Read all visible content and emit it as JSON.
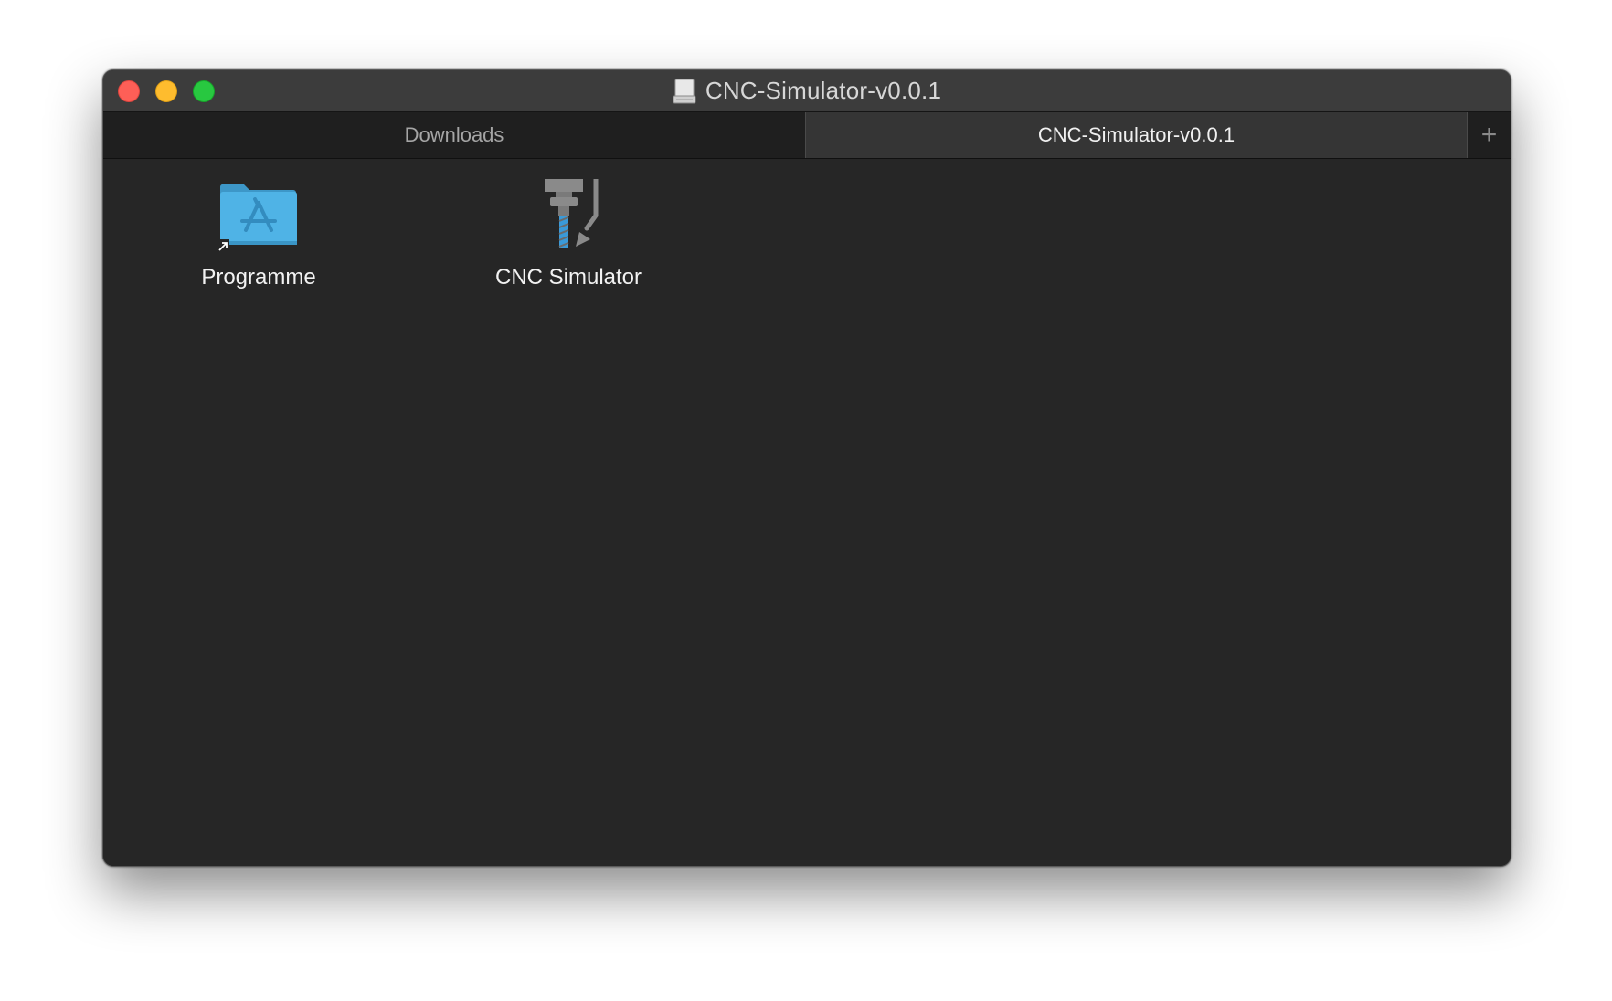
{
  "window": {
    "title": "CNC-Simulator-v0.0.1",
    "title_icon": "disk-image-icon"
  },
  "tabs": [
    {
      "label": "Downloads",
      "active": false
    },
    {
      "label": "CNC-Simulator-v0.0.1",
      "active": true
    }
  ],
  "new_tab_glyph": "+",
  "items": [
    {
      "label": "Programme",
      "icon": "applications-folder-alias-icon"
    },
    {
      "label": "CNC Simulator",
      "icon": "cnc-simulator-app-icon"
    }
  ],
  "colors": {
    "window_bg": "#262626",
    "titlebar_bg": "#3c3c3c",
    "folder_blue": "#4fb3e6",
    "close": "#fe5f57",
    "minimize": "#febc2e",
    "maximize": "#28c840"
  }
}
